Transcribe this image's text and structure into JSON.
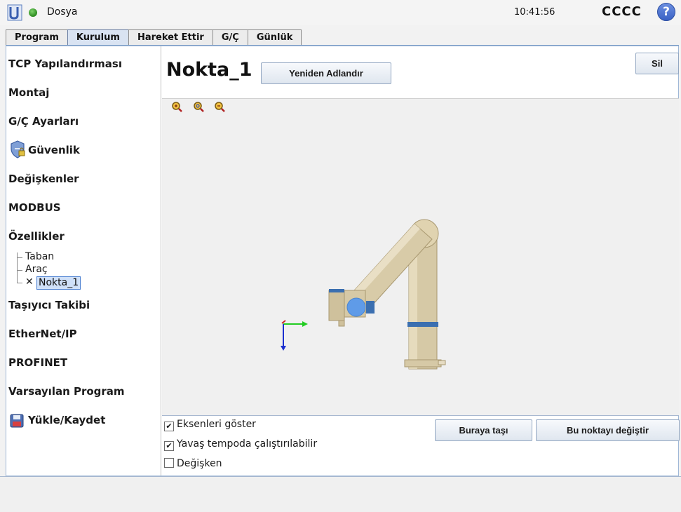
{
  "header": {
    "file_menu": "Dosya",
    "time": "10:41:56",
    "robot_name": "CCCC",
    "help": "?"
  },
  "tabs": [
    {
      "label": "Program",
      "active": false
    },
    {
      "label": "Kurulum",
      "active": true
    },
    {
      "label": "Hareket Ettir",
      "active": false
    },
    {
      "label": "G/Ç",
      "active": false
    },
    {
      "label": "Günlük",
      "active": false
    }
  ],
  "sidebar": {
    "items": [
      {
        "label": "TCP Yapılandırması"
      },
      {
        "label": "Montaj"
      },
      {
        "label": "G/Ç Ayarları"
      },
      {
        "label": "Güvenlik"
      },
      {
        "label": "Değişkenler"
      },
      {
        "label": "MODBUS"
      },
      {
        "label": "Özellikler"
      },
      {
        "label": "Taşıyıcı Takibi"
      },
      {
        "label": "EtherNet/IP"
      },
      {
        "label": "PROFINET"
      },
      {
        "label": "Varsayılan Program"
      },
      {
        "label": "Yükle/Kaydet"
      }
    ],
    "features_tree": [
      "Taban",
      "Araç",
      "Nokta_1"
    ]
  },
  "main": {
    "title": "Nokta_1",
    "rename_button": "Yeniden Adlandır",
    "delete_button": "Sil",
    "checkboxes": [
      {
        "label": "Eksenleri göster",
        "checked": true
      },
      {
        "label": "Yavaş tempoda çalıştırılabilir",
        "checked": true
      },
      {
        "label": "Değişken",
        "checked": false
      }
    ],
    "move_here_button": "Buraya taşı",
    "change_point_button": "Bu noktayı değiştir"
  },
  "colors": {
    "accent": "#7fa0c9",
    "active_tab": "#d9e3f2",
    "robot_body": "#d8cba8",
    "joint_ring": "#3b6fb0"
  }
}
